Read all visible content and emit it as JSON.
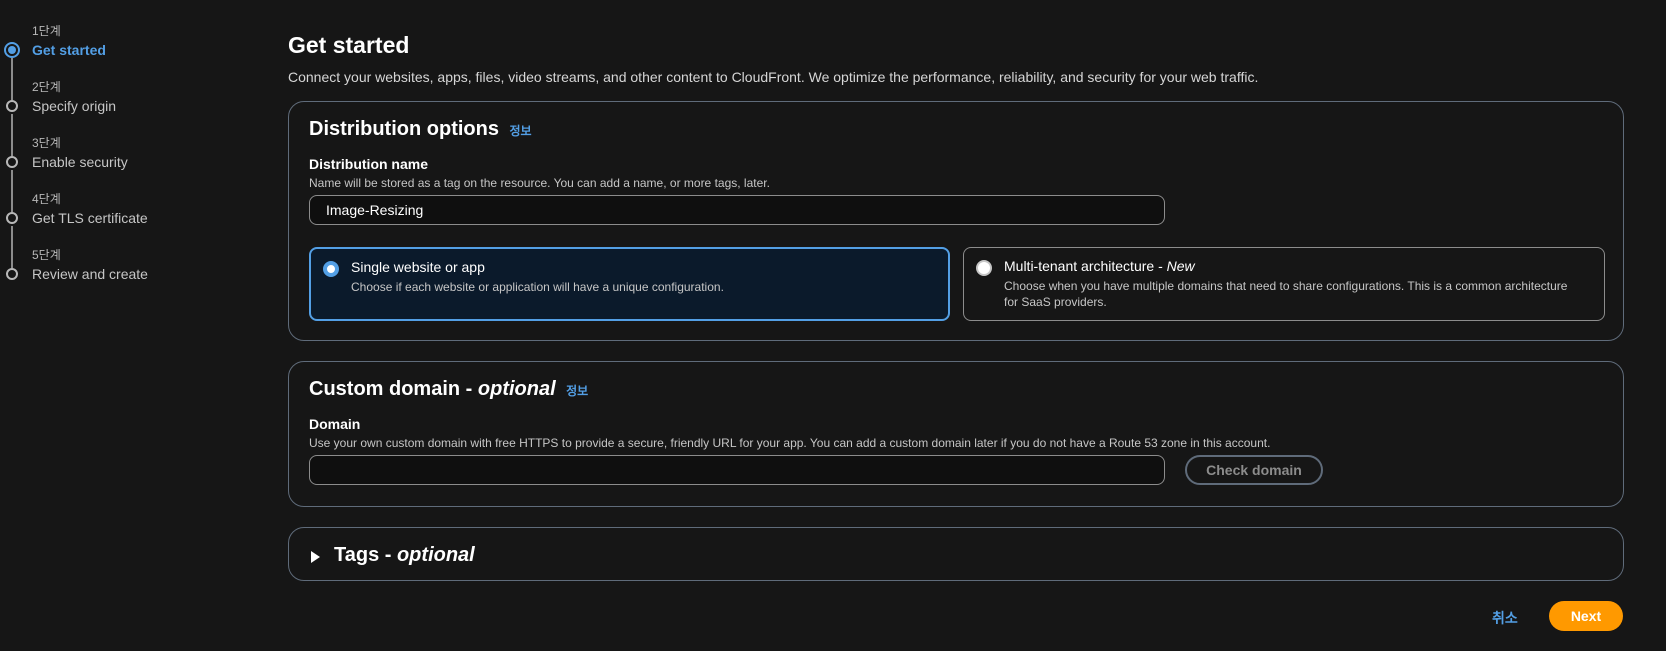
{
  "stepper": {
    "steps": [
      {
        "num": "1단계",
        "label": "Get started"
      },
      {
        "num": "2단계",
        "label": "Specify origin"
      },
      {
        "num": "3단계",
        "label": "Enable security"
      },
      {
        "num": "4단계",
        "label": "Get TLS certificate"
      },
      {
        "num": "5단계",
        "label": "Review and create"
      }
    ]
  },
  "header": {
    "title": "Get started",
    "description": "Connect your websites, apps, files, video streams, and other content to CloudFront. We optimize the performance, reliability, and security for your web traffic."
  },
  "distribution": {
    "title": "Distribution options",
    "info": "정보",
    "name_label": "Distribution name",
    "name_desc": "Name will be stored as a tag on the resource. You can add a name, or more tags, later.",
    "name_value": "Image-Resizing",
    "options": [
      {
        "title": "Single website or app",
        "desc": "Choose if each website or application will have a unique configuration."
      },
      {
        "title": "Multi-tenant architecture - ",
        "title_em": "New",
        "desc": "Choose when you have multiple domains that need to share configurations. This is a common architecture for SaaS providers."
      }
    ]
  },
  "custom_domain": {
    "title": "Custom domain - ",
    "title_em": "optional",
    "info": "정보",
    "label": "Domain",
    "desc": "Use your own custom domain with free HTTPS to provide a secure, friendly URL for your app. You can add a custom domain later if you do not have a Route 53 zone in this account.",
    "value": "",
    "check_button": "Check domain"
  },
  "tags": {
    "title": "Tags - ",
    "title_em": "optional"
  },
  "footer": {
    "cancel": "취소",
    "next": "Next"
  },
  "colors": {
    "accent": "#539fe5",
    "primary_button": "#ff9900",
    "background": "#161616"
  }
}
